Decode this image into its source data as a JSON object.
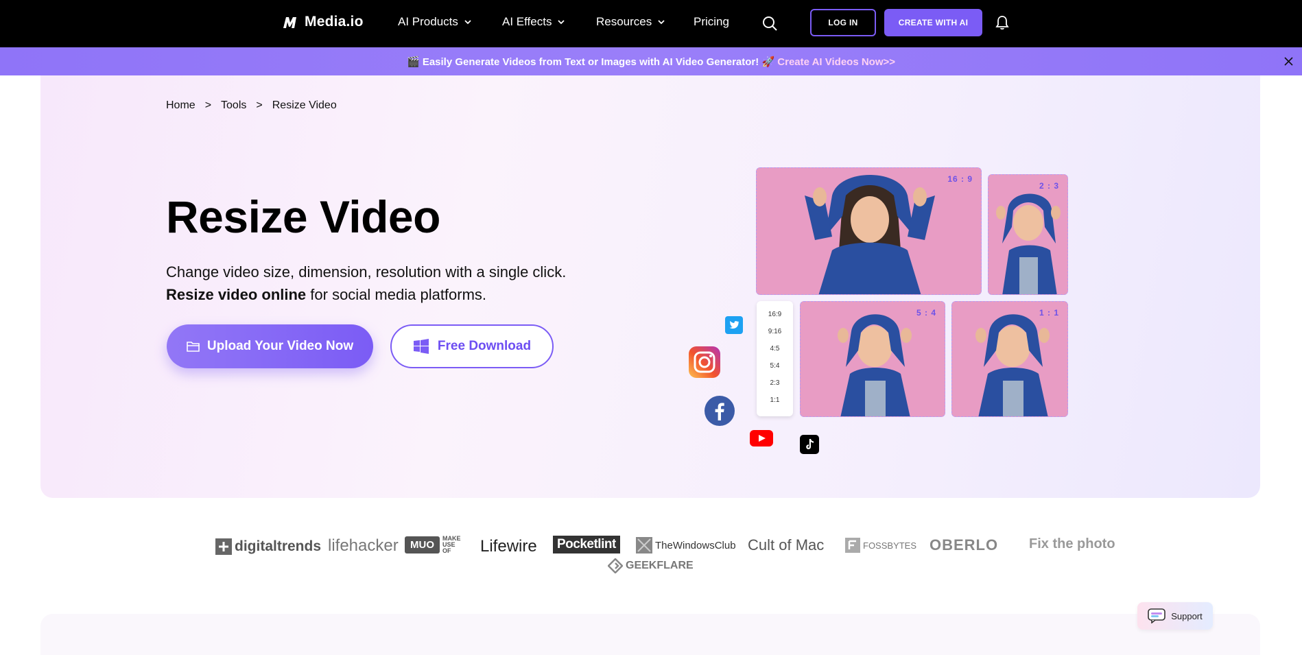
{
  "nav": {
    "brand": "Media.io",
    "items": [
      {
        "label": "AI Products",
        "has_dropdown": true
      },
      {
        "label": "AI Effects",
        "has_dropdown": true
      },
      {
        "label": "Resources",
        "has_dropdown": true
      },
      {
        "label": "Pricing",
        "has_dropdown": false
      }
    ],
    "search_icon": "search-icon",
    "login_label": "LOG IN",
    "create_label": "CREATE WITH AI",
    "bell_icon": "bell-icon"
  },
  "promo": {
    "emoji_start": "🎬",
    "text": "Easily Generate Videos from Text or Images with AI Video Generator!",
    "emoji_mid": "🚀",
    "link": "Create AI Videos Now>>"
  },
  "breadcrumb": {
    "items": [
      "Home",
      "Tools",
      "Resize Video"
    ],
    "separator": ">"
  },
  "hero": {
    "title": "Resize Video",
    "desc_line1": "Change video size, dimension, resolution with a single click.",
    "desc_bold": "Resize video online",
    "desc_rest": " for social media platforms.",
    "upload_label": "Upload Your Video Now",
    "download_label": "Free Download"
  },
  "collage": {
    "tiles": [
      {
        "ratio": "16 : 9"
      },
      {
        "ratio": "2 : 3"
      },
      {
        "ratio": "5 : 4"
      },
      {
        "ratio": "1 : 1"
      }
    ],
    "ratio_options": [
      "16:9",
      "9:16",
      "4:5",
      "5:4",
      "2:3",
      "1:1"
    ]
  },
  "press_logos": [
    "digitaltrends",
    "lifehacker",
    "MUO",
    "Lifewire",
    "Pocketlint",
    "TheWindowsClub",
    "Cult of Mac",
    "FOSSBYTES",
    "OBERLO",
    "Fix the photo",
    "GEEKFLARE"
  ],
  "support": {
    "label": "Support"
  },
  "colors": {
    "accent": "#7b5cf5",
    "promo_bg": "#9a7ff9",
    "promo_link": "#ffd1f4",
    "tile_bg": "#e89cc4"
  }
}
